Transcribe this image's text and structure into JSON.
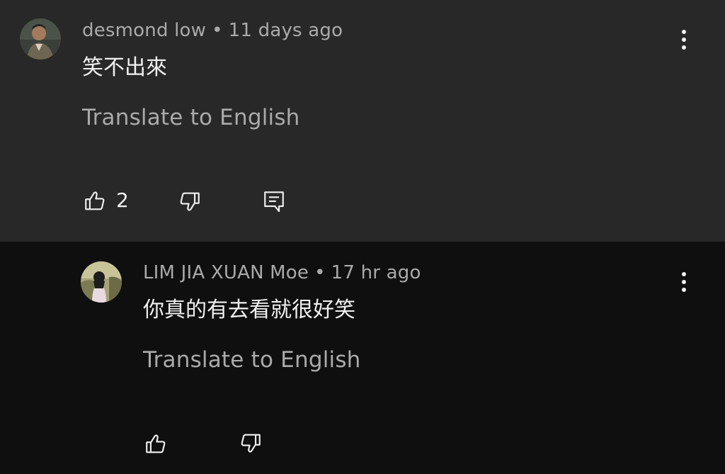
{
  "comments": [
    {
      "author": "desmond low",
      "separator": "•",
      "time": "11 days ago",
      "text": "笑不出來",
      "translate_label": "Translate to English",
      "like_count": "2",
      "has_reply_button": true
    },
    {
      "author": "LIM JIA XUAN Moe",
      "separator": "•",
      "time": "17 hr ago",
      "text": "你真的有去看就很好笑",
      "translate_label": "Translate to English",
      "like_count": "",
      "has_reply_button": false
    }
  ],
  "icons": {
    "like": "thumb-up-icon",
    "dislike": "thumb-down-icon",
    "reply": "comment-reply-icon",
    "menu": "more-vertical-icon"
  },
  "colors": {
    "comment_bg_highlight": "#282828",
    "page_bg": "#0f0f0f",
    "primary_text": "#f1f1f1",
    "secondary_text": "#aaaaaa"
  }
}
